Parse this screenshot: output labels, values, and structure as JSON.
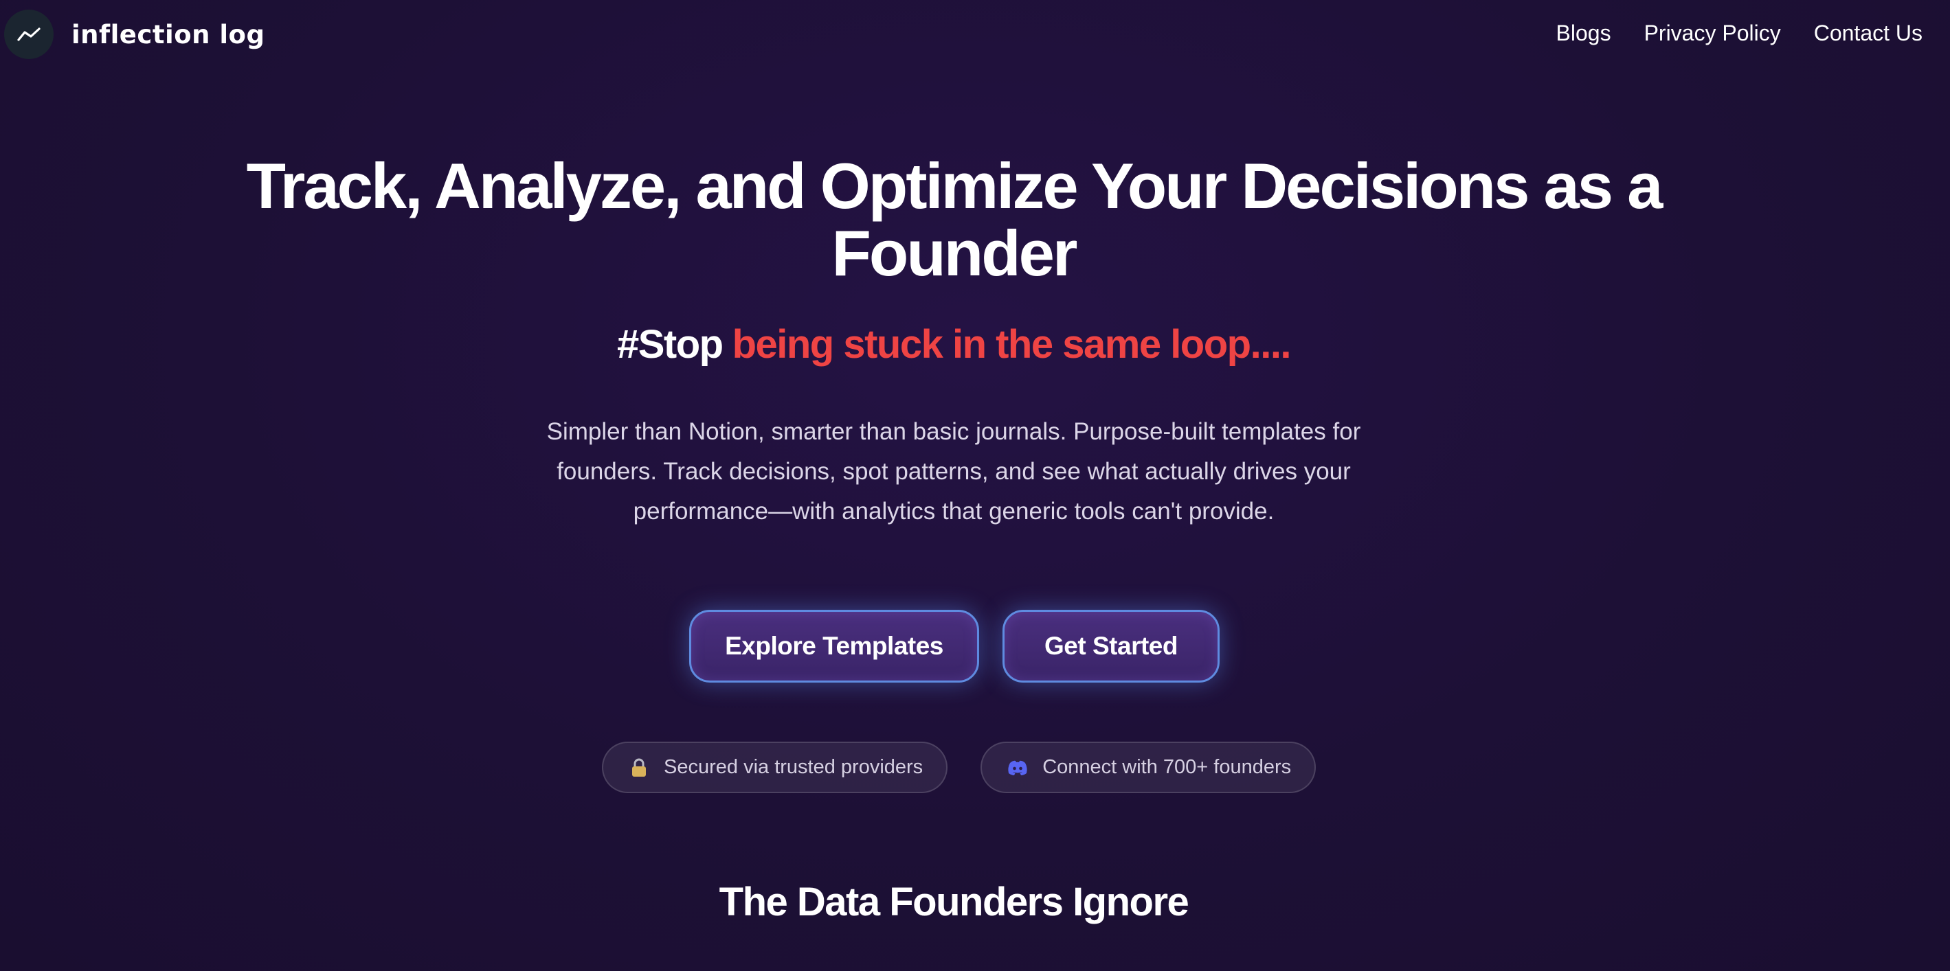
{
  "nav": {
    "brand": "inflection log",
    "links": [
      "Blogs",
      "Privacy Policy",
      "Contact Us"
    ]
  },
  "hero": {
    "title_line1": "Track, Analyze, and Optimize Your Decisions as a",
    "title_line2": "Founder",
    "tagline_prefix": "#Stop",
    "tagline_highlight": "being stuck in the same loop....",
    "description": "Simpler than Notion, smarter than basic journals. Purpose-built templates for founders. Track decisions, spot patterns, and see what actually drives your performance—with analytics that generic tools can't provide."
  },
  "cta": {
    "explore": "Explore Templates",
    "start": "Get Started"
  },
  "badges": {
    "secure": "Secured via trusted providers",
    "community": "Connect with 700+ founders"
  },
  "section": {
    "title": "The Data Founders Ignore"
  },
  "colors": {
    "background": "#1e1038",
    "accent_red": "#ef4444",
    "button_border": "#5f8be0",
    "button_fill": "#3f2870",
    "discord": "#5865f2"
  },
  "icons": {
    "logo": "trend-line-icon",
    "secure": "lock-icon",
    "community": "discord-icon"
  }
}
